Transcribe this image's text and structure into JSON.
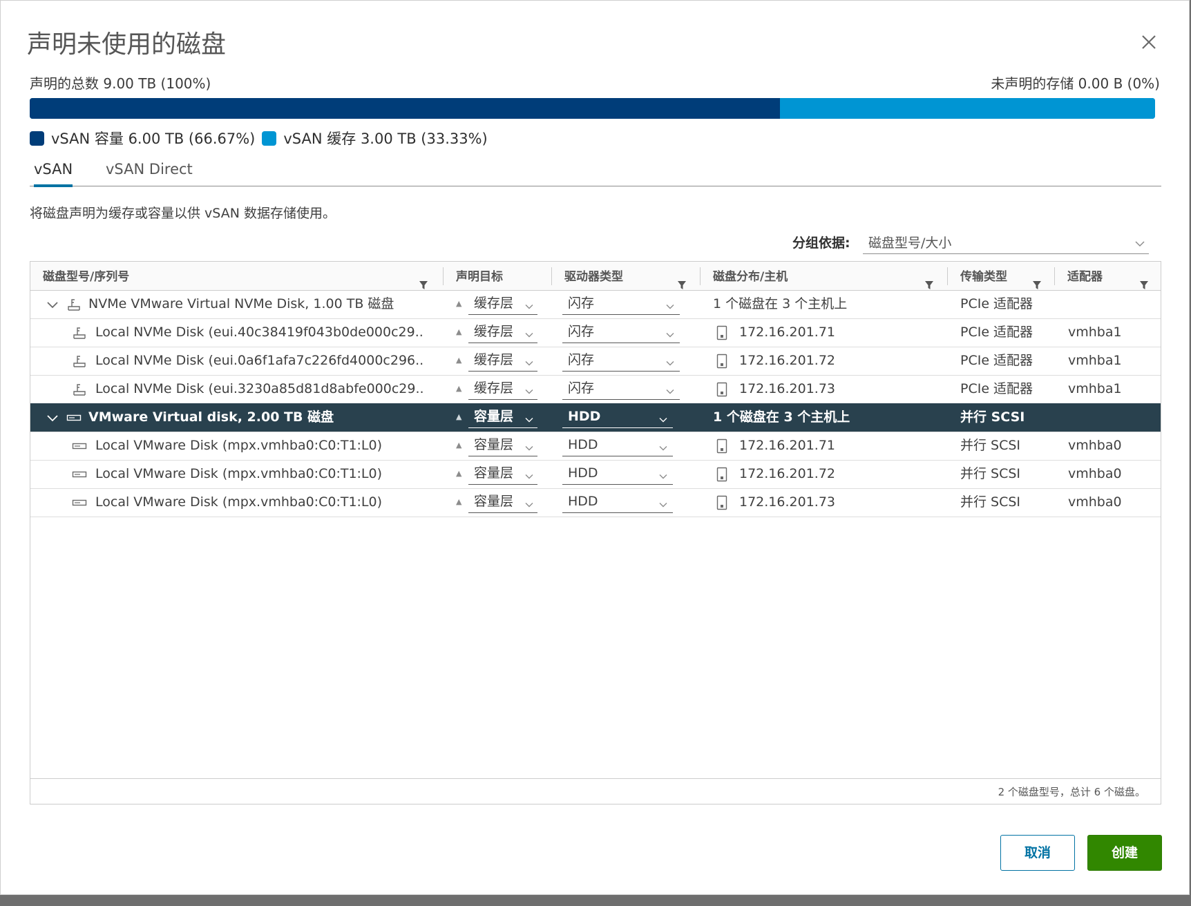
{
  "dialog": {
    "title": "声明未使用的磁盘",
    "summary_left": "声明的总数 9.00 TB (100%)",
    "summary_right": "未声明的存储 0.00 B (0%)"
  },
  "capacity_bar": {
    "capacity_fraction": 0.6667,
    "cache_fraction": 0.3333,
    "capacity_color": "#003d79",
    "cache_color": "#0095d3"
  },
  "legend": [
    {
      "label": "vSAN 容量 6.00 TB (66.67%)",
      "color": "#003d79"
    },
    {
      "label": "vSAN 缓存 3.00 TB (33.33%)",
      "color": "#0095d3"
    }
  ],
  "tabs": [
    {
      "label": "vSAN",
      "active": true
    },
    {
      "label": "vSAN Direct",
      "active": false
    }
  ],
  "description": "将磁盘声明为缓存或容量以供 vSAN 数据存储使用。",
  "group_by": {
    "label": "分组依据:",
    "value": "磁盘型号/大小"
  },
  "table": {
    "columns": [
      "磁盘型号/序列号",
      "声明目标",
      "驱动器类型",
      "磁盘分布/主机",
      "传输类型",
      "适配器"
    ],
    "rows": [
      {
        "type": "group",
        "name": "NVMe VMware Virtual NVMe Disk, 1.00 TB 磁盘",
        "claim": "缓存层",
        "drive": "闪存",
        "distribution": "1 个磁盘在 3 个主机上",
        "transport": "PCIe 适配器",
        "adapter": "",
        "icon": "flash-disk-icon",
        "selected": false
      },
      {
        "type": "child",
        "name": "Local NVMe Disk (eui.40c38419f043b0de000c29...",
        "claim": "缓存层",
        "drive": "闪存",
        "distribution": "172.16.201.71",
        "transport": "PCIe 适配器",
        "adapter": "vmhba1",
        "icon": "flash-disk-icon",
        "selected": false
      },
      {
        "type": "child",
        "name": "Local NVMe Disk (eui.0a6f1afa7c226fd4000c296...",
        "claim": "缓存层",
        "drive": "闪存",
        "distribution": "172.16.201.72",
        "transport": "PCIe 适配器",
        "adapter": "vmhba1",
        "icon": "flash-disk-icon",
        "selected": false
      },
      {
        "type": "child",
        "name": "Local NVMe Disk (eui.3230a85d81d8abfe000c29...",
        "claim": "缓存层",
        "drive": "闪存",
        "distribution": "172.16.201.73",
        "transport": "PCIe 适配器",
        "adapter": "vmhba1",
        "icon": "flash-disk-icon",
        "selected": false
      },
      {
        "type": "group",
        "name": "VMware Virtual disk, 2.00 TB 磁盘",
        "claim": "容量层",
        "drive": "HDD",
        "distribution": "1 个磁盘在 3 个主机上",
        "transport": "并行 SCSI",
        "adapter": "",
        "icon": "hdd-disk-icon",
        "selected": true
      },
      {
        "type": "child",
        "name": "Local VMware Disk (mpx.vmhba0:C0:T1:L0)",
        "claim": "容量层",
        "drive": "HDD",
        "distribution": "172.16.201.71",
        "transport": "并行 SCSI",
        "adapter": "vmhba0",
        "icon": "hdd-disk-icon",
        "selected": false
      },
      {
        "type": "child",
        "name": "Local VMware Disk (mpx.vmhba0:C0:T1:L0)",
        "claim": "容量层",
        "drive": "HDD",
        "distribution": "172.16.201.72",
        "transport": "并行 SCSI",
        "adapter": "vmhba0",
        "icon": "hdd-disk-icon",
        "selected": false
      },
      {
        "type": "child",
        "name": "Local VMware Disk (mpx.vmhba0:C0:T1:L0)",
        "claim": "容量层",
        "drive": "HDD",
        "distribution": "172.16.201.73",
        "transport": "并行 SCSI",
        "adapter": "vmhba0",
        "icon": "hdd-disk-icon",
        "selected": false
      }
    ],
    "footer": "2 个磁盘型号，总计 6 个磁盘。"
  },
  "buttons": {
    "cancel": "取消",
    "create": "创建"
  }
}
